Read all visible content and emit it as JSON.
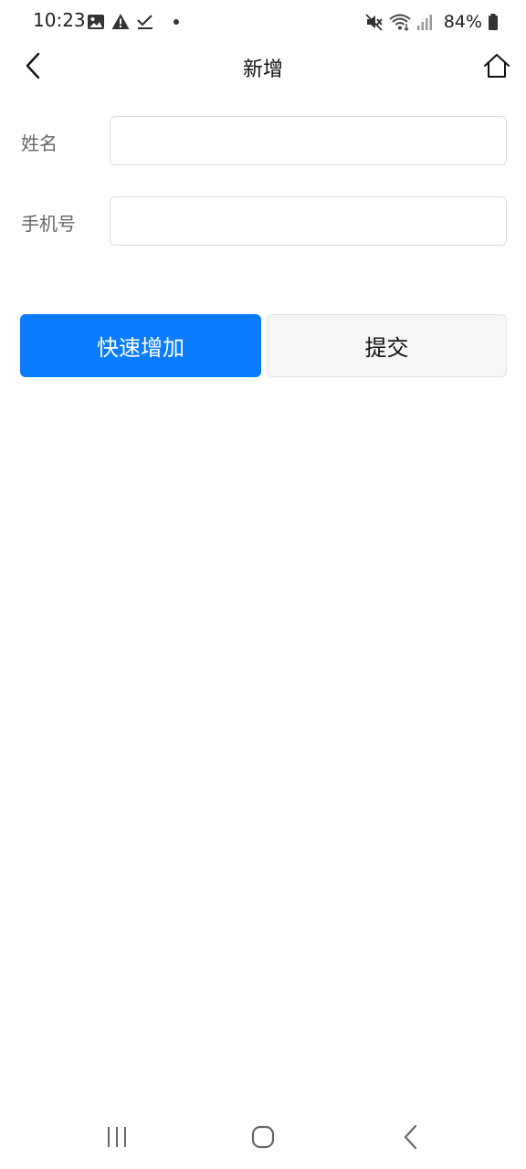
{
  "status_bar": {
    "time": "10:23",
    "battery": "84%",
    "left_icons": [
      "gallery-icon",
      "warning-icon",
      "check-icon",
      "dot-icon"
    ],
    "right_icons": [
      "mute-icon",
      "wifi-icon",
      "signal-icon",
      "battery-icon"
    ]
  },
  "header": {
    "title": "新增",
    "back_icon": "chevron-left-icon",
    "home_icon": "home-icon"
  },
  "form": {
    "name_label": "姓名",
    "name_value": "",
    "phone_label": "手机号",
    "phone_value": ""
  },
  "actions": {
    "quick_add_label": "快速增加",
    "submit_label": "提交"
  },
  "colors": {
    "primary": "#0a7cff",
    "secondary_bg": "#f6f6f6"
  },
  "nav_bar": {
    "icons": [
      "recent-apps-icon",
      "home-icon",
      "back-icon"
    ]
  }
}
